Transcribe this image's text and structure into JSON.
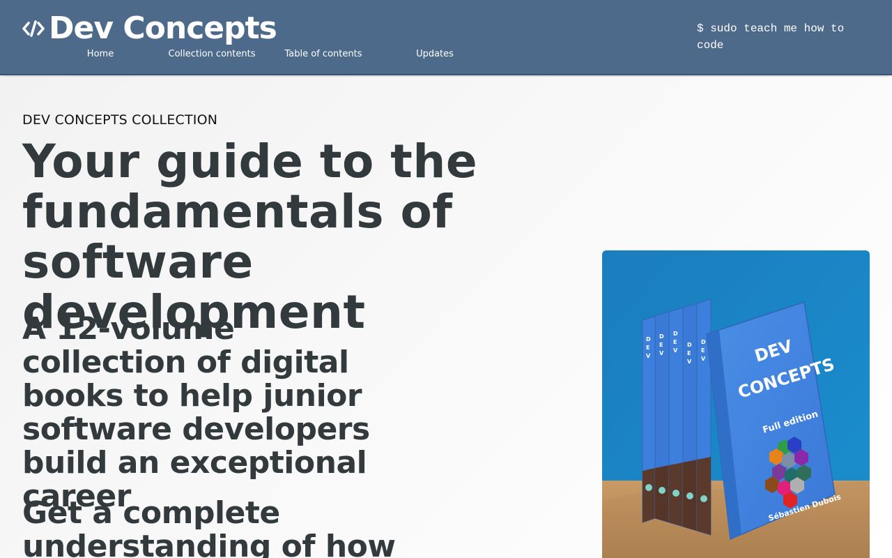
{
  "header": {
    "brand": "Dev Concepts",
    "logo_icon": "code-slash-icon",
    "nav": [
      {
        "label": "Home"
      },
      {
        "label": "Collection contents"
      },
      {
        "label": "Table of contents"
      },
      {
        "label": "Updates"
      }
    ],
    "tagline": "$ sudo teach me how to code"
  },
  "hero": {
    "eyebrow": "DEV CONCEPTS COLLECTION",
    "title": "Your guide to the fundamentals of software development",
    "subtitle": "A 12-volume collection of digital books to help junior software developers build an exceptional career",
    "subtitle2": "Get a complete understanding of how",
    "image": {
      "spine_label": "DEV CONCEPTS",
      "cover_title_line1": "DEV",
      "cover_title_line2": "CONCEPTS",
      "cover_edition": "Full edition",
      "cover_author": "Sébastien Dubois"
    }
  },
  "colors": {
    "header_bg": "#4d6a8a",
    "text_dark": "#333a3e",
    "image_bg": "#1f86c4",
    "book_blue": "#3b82e0",
    "book_brown": "#5a3a2c"
  }
}
